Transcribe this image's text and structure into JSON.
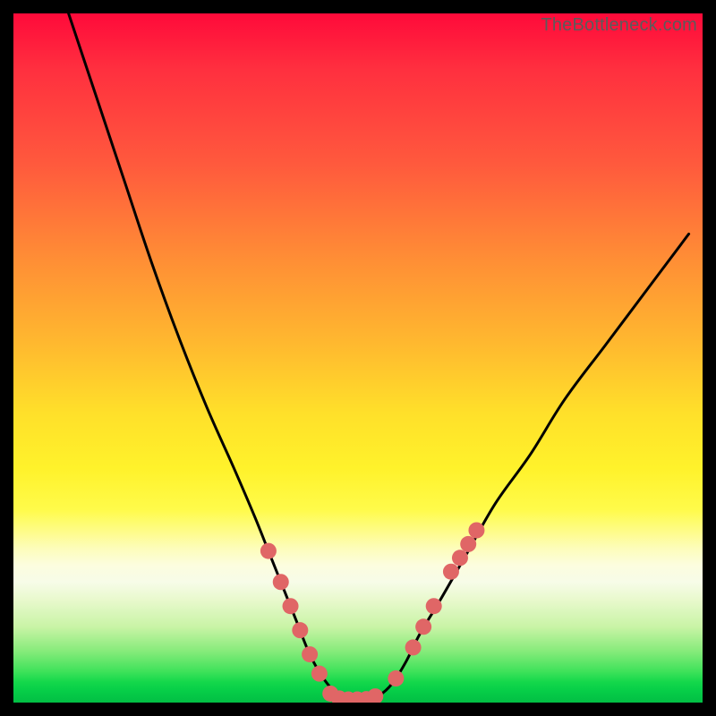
{
  "watermark": "TheBottleneck.com",
  "colors": {
    "page_bg": "#000000",
    "curve_stroke": "#000000",
    "marker_fill": "#e06666",
    "gradient_top": "#ff0a3a",
    "gradient_bottom": "#02bf44"
  },
  "chart_data": {
    "type": "line",
    "title": "",
    "xlabel": "",
    "ylabel": "",
    "xlim": [
      0,
      100
    ],
    "ylim": [
      0,
      100
    ],
    "grid": false,
    "legend": false,
    "notes": "Bottleneck-style V curve. Axes are implicit (no tick labels shown). x roughly = relative component strength, y = bottleneck %. Gradient background encodes severity (red=high, green=low). Salmon markers highlight points along the curve on its lower flanks and its flat bottom around x≈46–53.",
    "series": [
      {
        "name": "bottleneck-curve",
        "x": [
          8,
          12,
          16,
          20,
          24,
          28,
          32,
          35,
          37,
          39,
          41,
          43,
          45,
          47,
          49,
          51,
          53,
          55,
          57,
          59,
          62,
          66,
          70,
          75,
          80,
          86,
          92,
          98
        ],
        "values": [
          100,
          88,
          76,
          64,
          53,
          43,
          34,
          27,
          22,
          17,
          12,
          7,
          3.5,
          1.2,
          0.5,
          0.5,
          1.0,
          2.8,
          6,
          10,
          15,
          22,
          29,
          36,
          44,
          52,
          60,
          68
        ]
      }
    ],
    "markers": [
      {
        "x": 37.0,
        "y": 22.0
      },
      {
        "x": 38.8,
        "y": 17.5
      },
      {
        "x": 40.2,
        "y": 14.0
      },
      {
        "x": 41.6,
        "y": 10.5
      },
      {
        "x": 43.0,
        "y": 7.0
      },
      {
        "x": 44.4,
        "y": 4.2
      },
      {
        "x": 46.0,
        "y": 1.3
      },
      {
        "x": 47.3,
        "y": 0.6
      },
      {
        "x": 48.6,
        "y": 0.45
      },
      {
        "x": 49.9,
        "y": 0.45
      },
      {
        "x": 51.2,
        "y": 0.5
      },
      {
        "x": 52.5,
        "y": 0.9
      },
      {
        "x": 55.5,
        "y": 3.5
      },
      {
        "x": 58.0,
        "y": 8.0
      },
      {
        "x": 59.5,
        "y": 11.0
      },
      {
        "x": 61.0,
        "y": 14.0
      },
      {
        "x": 63.5,
        "y": 19.0
      },
      {
        "x": 64.8,
        "y": 21.0
      },
      {
        "x": 66.0,
        "y": 23.0
      },
      {
        "x": 67.2,
        "y": 25.0
      }
    ]
  }
}
